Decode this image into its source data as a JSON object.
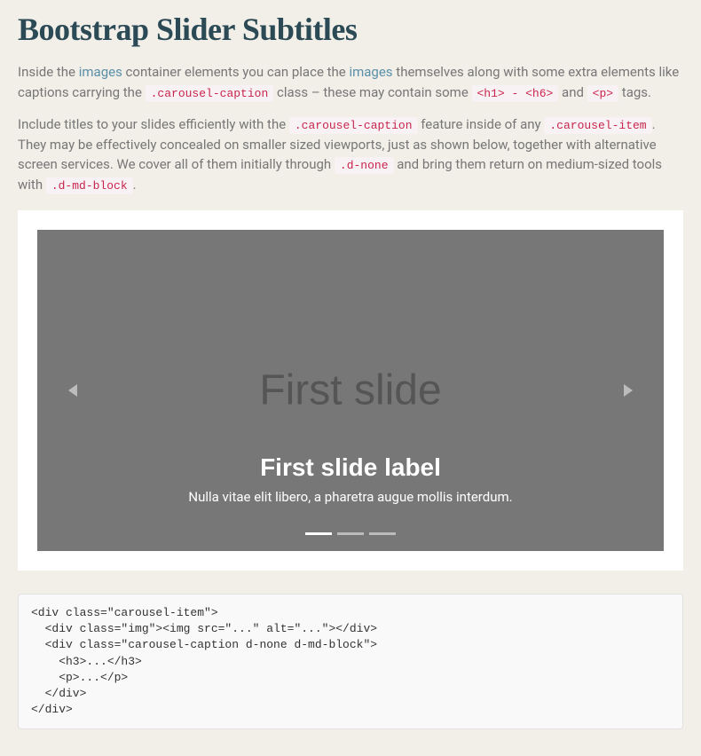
{
  "heading": "Bootstrap Slider Subtitles",
  "para1": {
    "t1": "Inside the ",
    "link1": "images",
    "t2": " container elements you can place the ",
    "link2": "images",
    "t3": " themselves along with some extra elements like captions carrying the ",
    "code1": ".carousel-caption",
    "t4": " class – these may contain some ",
    "code2": "<h1> - <h6>",
    "t5": " and ",
    "code3": "<p>",
    "t6": " tags."
  },
  "para2": {
    "t1": "Include titles to your slides efficiently with the ",
    "code1": ".carousel-caption",
    "t2": " feature inside of any ",
    "code2": ".carousel-item",
    "t3": ". They may be effectively concealed on smaller sized viewports, just as shown below, together with alternative screen services. We cover all of them initially through ",
    "code3": ".d-none",
    "t4": " and bring them return on medium-sized tools with ",
    "code4": ".d-md-block",
    "t5": "."
  },
  "carousel": {
    "bg_label": "First slide",
    "caption_title": "First slide label",
    "caption_text": "Nulla vitae elit libero, a pharetra augue mollis interdum."
  },
  "code_block": "<div class=\"carousel-item\">\n  <div class=\"img\"><img src=\"...\" alt=\"...\"></div>\n  <div class=\"carousel-caption d-none d-md-block\">\n    <h3>...</h3>\n    <p>...</p>\n  </div>\n</div>"
}
